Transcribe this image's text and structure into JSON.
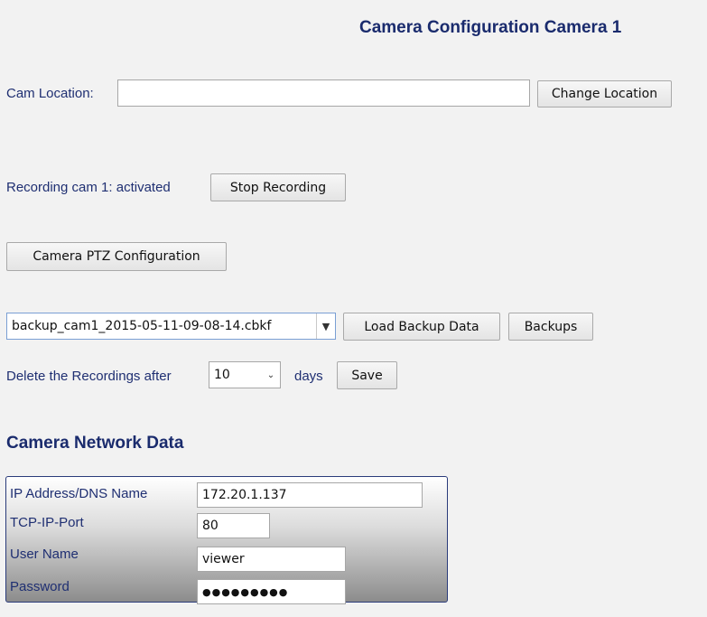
{
  "page_title": "Camera Configuration Camera 1",
  "location": {
    "label": "Cam Location:",
    "value": "",
    "button": "Change Location"
  },
  "recording": {
    "status_text": "Recording cam 1: activated",
    "button": "Stop Recording"
  },
  "ptz_button": "Camera PTZ Configuration",
  "backup": {
    "selected": "backup_cam1_2015-05-11-09-08-14.cbkf",
    "load_button": "Load Backup Data",
    "backups_button": "Backups"
  },
  "retention": {
    "label_before": "Delete the Recordings after",
    "selected": "10",
    "label_after": "days",
    "save_button": "Save"
  },
  "network": {
    "heading": "Camera Network Data",
    "rows": [
      {
        "label": "IP Address/DNS Name",
        "value": "172.20.1.137"
      },
      {
        "label": "TCP-IP-Port",
        "value": "80"
      },
      {
        "label": "User Name",
        "value": "viewer"
      },
      {
        "label": "Password",
        "value": "●●●●●●●●●"
      }
    ]
  }
}
